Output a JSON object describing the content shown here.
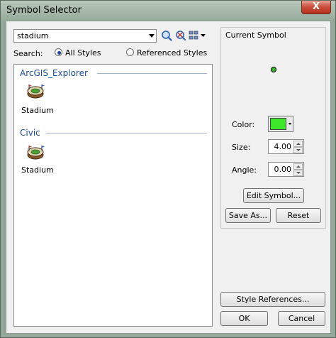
{
  "window": {
    "title": "Symbol Selector",
    "close_glyph": "X"
  },
  "search": {
    "value": "stadium",
    "label": "Search:",
    "options": [
      "All Styles",
      "Referenced Styles"
    ],
    "selected": "All Styles"
  },
  "toolbar": {
    "icons": [
      "search-icon",
      "refresh-search-icon",
      "view-options-icon"
    ]
  },
  "groups": [
    {
      "name": "ArcGIS_Explorer",
      "items": [
        {
          "label": "Stadium",
          "icon": "stadium-icon"
        }
      ]
    },
    {
      "name": "Civic",
      "items": [
        {
          "label": "Stadium",
          "icon": "stadium-icon"
        }
      ]
    }
  ],
  "current_symbol": {
    "label": "Current Symbol",
    "color_label": "Color:",
    "color": "#3ce82a",
    "size_label": "Size:",
    "size": "4.00",
    "angle_label": "Angle:",
    "angle": "0.00",
    "edit_button": "Edit Symbol...",
    "save_as_button": "Save As...",
    "reset_button": "Reset"
  },
  "footer": {
    "style_references_button": "Style References...",
    "ok_button": "OK",
    "cancel_button": "Cancel"
  }
}
